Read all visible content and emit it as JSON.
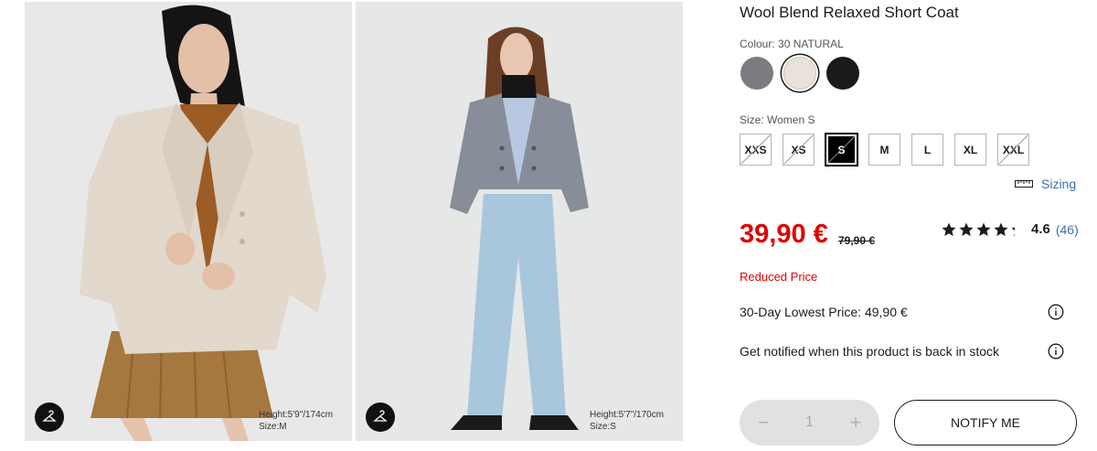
{
  "product": {
    "title": "Wool Blend Relaxed Short Coat",
    "colour_label": "Colour: 30 NATURAL",
    "colours": [
      {
        "name": "grey",
        "hex": "#7b7c80"
      },
      {
        "name": "natural",
        "hex": "#e9e2da"
      },
      {
        "name": "black",
        "hex": "#1a1a1a"
      }
    ],
    "selected_colour": "natural",
    "size_label": "Size: Women S",
    "sizes": [
      "XXS",
      "XS",
      "S",
      "M",
      "L",
      "XL",
      "XXL"
    ],
    "unavailable_sizes": [
      "XXS",
      "XS",
      "S",
      "XXL"
    ],
    "selected_size": "S",
    "sizing_link": "Sizing",
    "price": "39,90 €",
    "original_price": "79,90 €",
    "rating": {
      "stars": 4.6,
      "value": "4.6",
      "count": "(46)"
    },
    "reduced_label": "Reduced Price",
    "lowest_price": "30-Day Lowest Price: 49,90 €",
    "notify_text": "Get notified when this product is back in stock",
    "quantity": "1",
    "quantity_minus": "−",
    "quantity_plus": "+",
    "notify_button": "NOTIFY ME"
  },
  "gallery": [
    {
      "height": "Height:5'9\"/174cm",
      "size": "Size:M",
      "icon": "hanger-icon"
    },
    {
      "height": "Height:5'7\"/170cm",
      "size": "Size:S",
      "icon": "hanger-icon"
    }
  ],
  "colors": {
    "sale": "#e00000",
    "link": "#3a6fb0",
    "text": "#1b1b1b"
  }
}
